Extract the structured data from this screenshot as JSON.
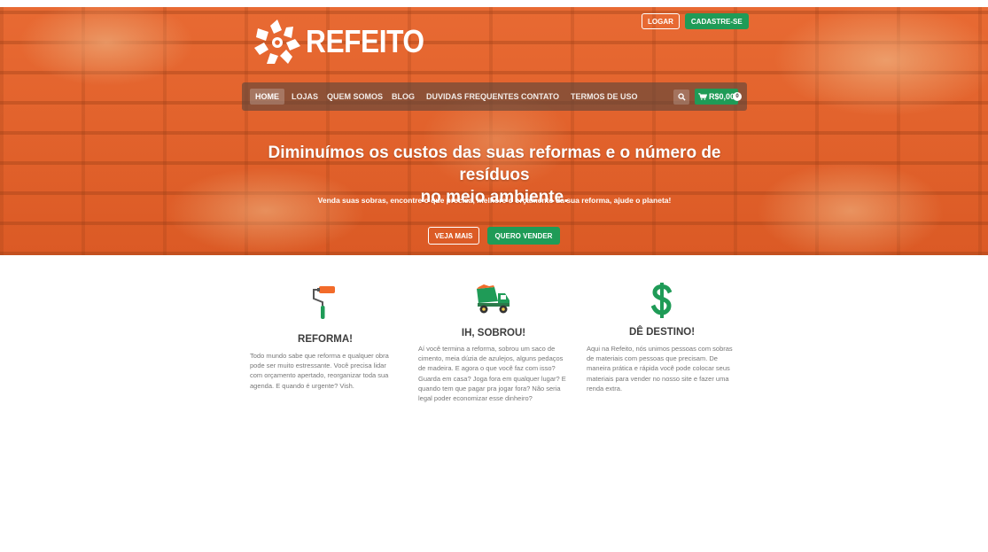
{
  "brand": {
    "name": "REFEITO",
    "logo_icon": "recycle-star-icon"
  },
  "auth": {
    "login_label": "LOGAR",
    "signup_label": "CADASTRE-SE"
  },
  "nav": {
    "items": [
      {
        "label": "HOME",
        "active": true
      },
      {
        "label": "LOJAS"
      },
      {
        "label": "QUEM SOMOS"
      },
      {
        "label": "BLOG"
      },
      {
        "label": "DUVIDAS FREQUENTES"
      },
      {
        "label": "CONTATO"
      },
      {
        "label": "TERMOS DE USO"
      }
    ],
    "search_icon": "search-icon",
    "cart": {
      "icon": "cart-icon",
      "total": "R$0,00",
      "count": "0"
    }
  },
  "hero": {
    "title_line1": "Diminuímos os custos das suas reformas e o número de resíduos",
    "title_line2": "no meio ambiente.",
    "subtitle": "Venda suas sobras, encontre o que precisa, melhore o orçamento da sua reforma, ajude o planeta!",
    "primary_button": "VEJA MAIS",
    "secondary_button": "QUERO VENDER"
  },
  "features": [
    {
      "icon": "paint-roller-icon",
      "title": "REFORMA!",
      "text": "Todo mundo sabe que reforma e qualquer obra pode ser muito estressante. Você precisa lidar com orçamento apertado, reorganizar toda sua agenda. E quando é urgente? Vish."
    },
    {
      "icon": "dump-truck-icon",
      "title": "IH, SOBROU!",
      "text": "Aí você termina a reforma, sobrou um saco de cimento, meia dúzia de azulejos, alguns pedaços de madeira. E agora o que você faz com isso? Guarda em casa? Joga fora em qualquer lugar? E quando tem que pagar pra jogar fora? Não seria legal poder economizar esse dinheiro?"
    },
    {
      "icon": "dollar-sign-icon",
      "title": "DÊ DESTINO!",
      "text": "Aqui na Refeito, nós unimos pessoas com sobras de materiais com pessoas que precisam. De maneira prática e rápida você pode colocar seus materiais para vender no nosso site e fazer uma renda extra."
    }
  ],
  "colors": {
    "accent": "#1f9b57",
    "hero": "#e4612c",
    "heading": "#3d3d3d",
    "body_text": "#777777"
  }
}
